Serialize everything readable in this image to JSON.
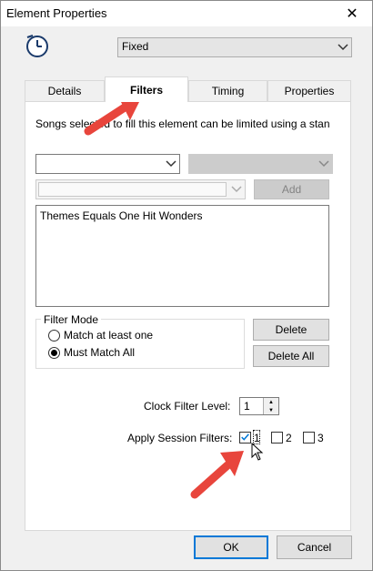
{
  "window": {
    "title": "Element Properties",
    "close_glyph": "✕"
  },
  "header": {
    "icon": "clock-icon",
    "type_select": {
      "selected": "Fixed"
    }
  },
  "tabs": [
    {
      "label": "Details",
      "active": false
    },
    {
      "label": "Filters",
      "active": true
    },
    {
      "label": "Timing",
      "active": false
    },
    {
      "label": "Properties",
      "active": false
    }
  ],
  "filters": {
    "description": "Songs selected to fill this element can be limited using a standa",
    "field_select": {
      "selected": ""
    },
    "operator_select": {
      "selected": ""
    },
    "value_select": {
      "selected": ""
    },
    "add_label": "Add",
    "list_items": [
      "Themes Equals One Hit Wonders"
    ],
    "filter_mode": {
      "label": "Filter Mode",
      "options": [
        {
          "label": "Match at least one",
          "selected": false
        },
        {
          "label": "Must Match All",
          "selected": true
        }
      ]
    },
    "delete_label": "Delete",
    "delete_all_label": "Delete All",
    "clock_filter_level": {
      "label": "Clock Filter Level:",
      "value": "1"
    },
    "session_filters": {
      "label": "Apply Session Filters:",
      "options": [
        {
          "label": "1",
          "checked": true
        },
        {
          "label": "2",
          "checked": false
        },
        {
          "label": "3",
          "checked": false
        }
      ]
    }
  },
  "footer": {
    "ok_label": "OK",
    "cancel_label": "Cancel"
  },
  "colors": {
    "accent": "#0078d7",
    "annotation_arrow": "#e8453c",
    "window_bg": "#f0f0f0",
    "panel_bg": "#ffffff"
  }
}
